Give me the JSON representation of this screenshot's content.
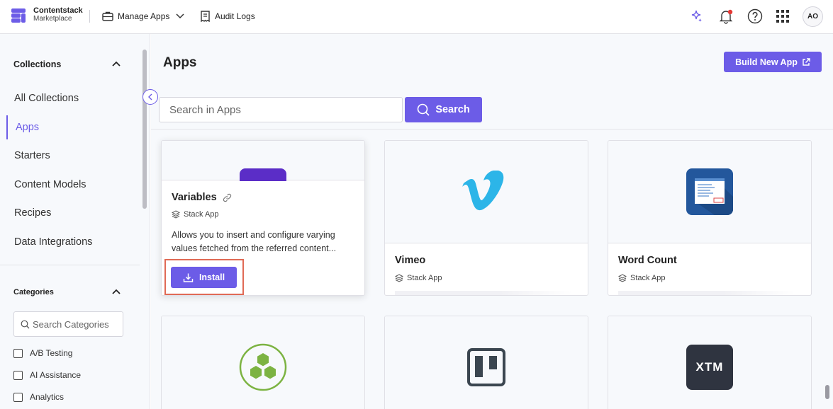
{
  "header": {
    "brand_name": "Contentstack",
    "brand_sub": "Marketplace",
    "nav": [
      {
        "label": "Manage Apps",
        "icon": "briefcase-icon"
      },
      {
        "label": "Audit Logs",
        "icon": "receipt-icon"
      }
    ],
    "icons": [
      "sparkle-icon",
      "bell-icon",
      "help-icon",
      "apps-grid-icon"
    ],
    "avatar_initials": "AO"
  },
  "sidebar": {
    "collections_heading": "Collections",
    "collections": [
      {
        "label": "All Collections"
      },
      {
        "label": "Apps",
        "active": true
      },
      {
        "label": "Starters"
      },
      {
        "label": "Content Models"
      },
      {
        "label": "Recipes"
      },
      {
        "label": "Data Integrations"
      }
    ],
    "categories_heading": "Categories",
    "category_search_placeholder": "Search Categories",
    "categories": [
      {
        "label": "A/B Testing",
        "checked": false
      },
      {
        "label": "AI Assistance",
        "checked": false
      },
      {
        "label": "Analytics",
        "checked": false
      }
    ]
  },
  "main": {
    "title": "Apps",
    "build_button": "Build New App",
    "search_placeholder": "Search in Apps",
    "search_button": "Search",
    "hover_card": {
      "title": "Variables",
      "type": "Stack App",
      "description": "Allows you to insert and configure varying values fetched from the referred content...",
      "install_label": "Install"
    },
    "cards": [
      {
        "title": "Vimeo",
        "type": "Stack App",
        "logo": "vimeo-logo"
      },
      {
        "title": "Word Count",
        "type": "Stack App",
        "logo": "word-count-logo"
      }
    ],
    "row2_logos": [
      "hexagon-cluster-logo",
      "trello-logo",
      "xtm-logo"
    ],
    "xtm_text": "XTM"
  },
  "colors": {
    "accent": "#6c5ce7",
    "highlight_outline": "#e06a55",
    "notification_dot": "#e53935"
  }
}
